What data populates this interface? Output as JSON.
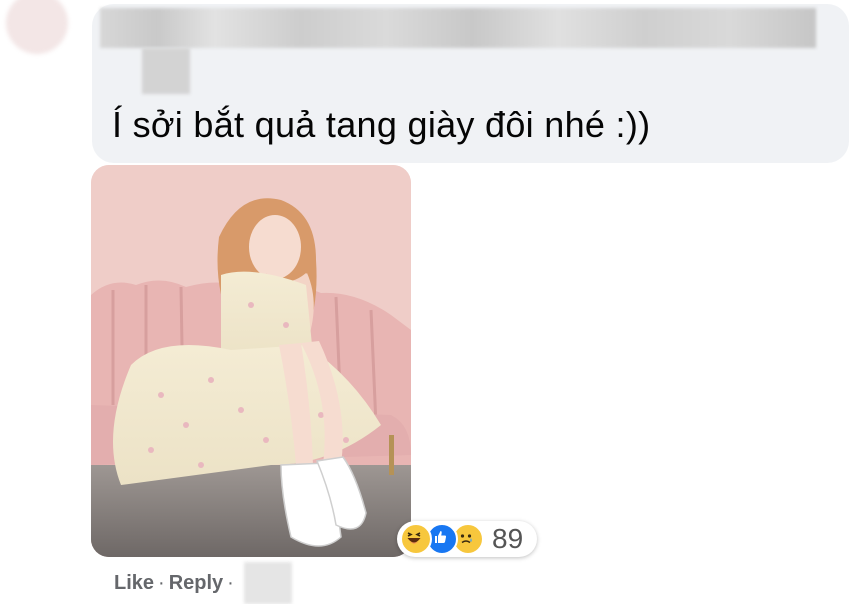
{
  "comment": {
    "text": "Í sởi bắt quả tang giày đôi nhé :))"
  },
  "photo": {
    "description_icon": "photo-of-woman-on-pink-sofa"
  },
  "reactions": {
    "icons": [
      "haha-icon",
      "like-icon",
      "sad-icon"
    ],
    "count": "89"
  },
  "actions": {
    "like_label": "Like",
    "separator": "·",
    "reply_label": "Reply"
  },
  "colors": {
    "bubble": "#f0f2f5",
    "action_text": "#65676b",
    "like_blue": "#1877f2",
    "emoji_yellow": "#f7c73d"
  }
}
